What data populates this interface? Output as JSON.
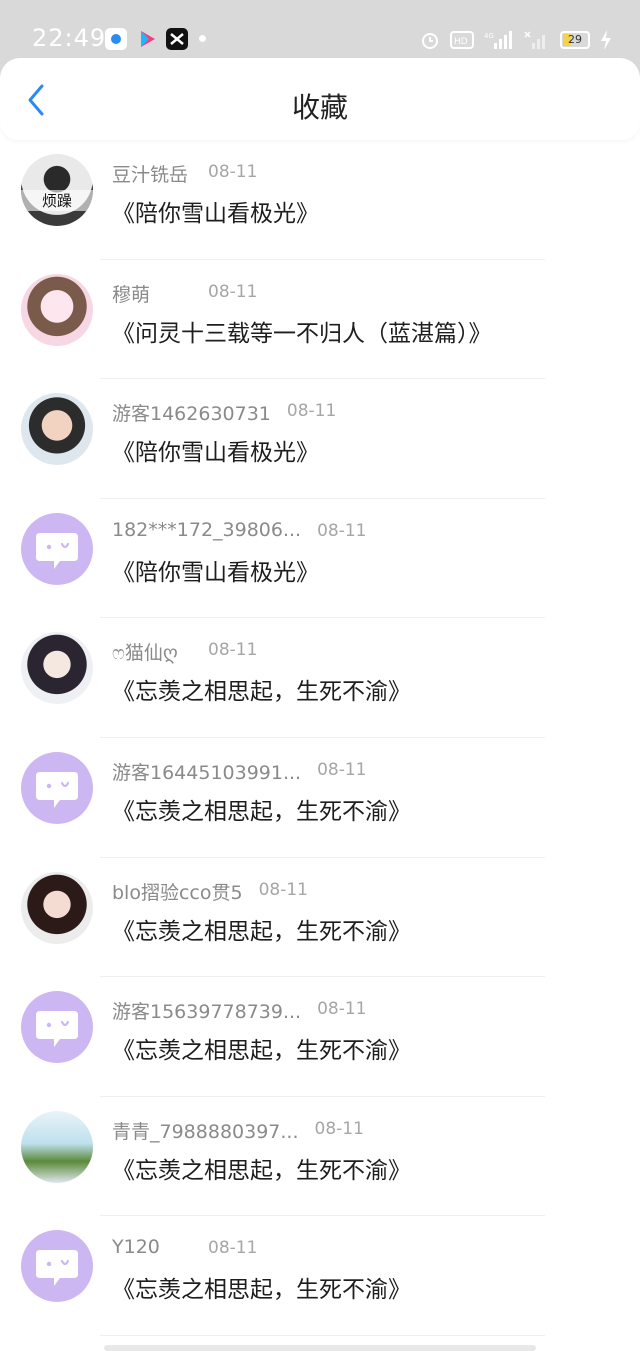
{
  "status": {
    "time": "22:49",
    "battery": "29"
  },
  "header": {
    "title": "收藏"
  },
  "items": [
    {
      "username": "豆汁铣岳",
      "date": "08-11",
      "book": "《陪你雪山看极光》",
      "avatar": "photo",
      "avatar_text": "烦躁"
    },
    {
      "username": "穆萌",
      "date": "08-11",
      "book": "《问灵十三载等一不归人（蓝湛篇）》",
      "avatar": "photo"
    },
    {
      "username": "游客1462630731",
      "date": "08-11",
      "book": "《陪你雪山看极光》",
      "avatar": "photo"
    },
    {
      "username": "182***172_39806...",
      "date": "08-11",
      "book": "《陪你雪山看极光》",
      "avatar": "default"
    },
    {
      "username": "ෆ猫仙ღ",
      "date": "08-11",
      "book": "《忘羡之相思起，生死不渝》",
      "avatar": "photo"
    },
    {
      "username": "游客16445103991...",
      "date": "08-11",
      "book": "《忘羡之相思起，生死不渝》",
      "avatar": "default"
    },
    {
      "username": "blo摺验cco贯5",
      "date": "08-11",
      "book": "《忘羡之相思起，生死不渝》",
      "avatar": "photo"
    },
    {
      "username": "游客15639778739...",
      "date": "08-11",
      "book": "《忘羡之相思起，生死不渝》",
      "avatar": "default"
    },
    {
      "username": "青青_7988880397...",
      "date": "08-11",
      "book": "《忘羡之相思起，生死不渝》",
      "avatar": "photo"
    },
    {
      "username": "Y120",
      "date": "08-11",
      "book": "《忘羡之相思起，生死不渝》",
      "avatar": "default"
    }
  ],
  "colors": {
    "accent": "#2a8bf2",
    "default_avatar": "#cdb7f2"
  }
}
